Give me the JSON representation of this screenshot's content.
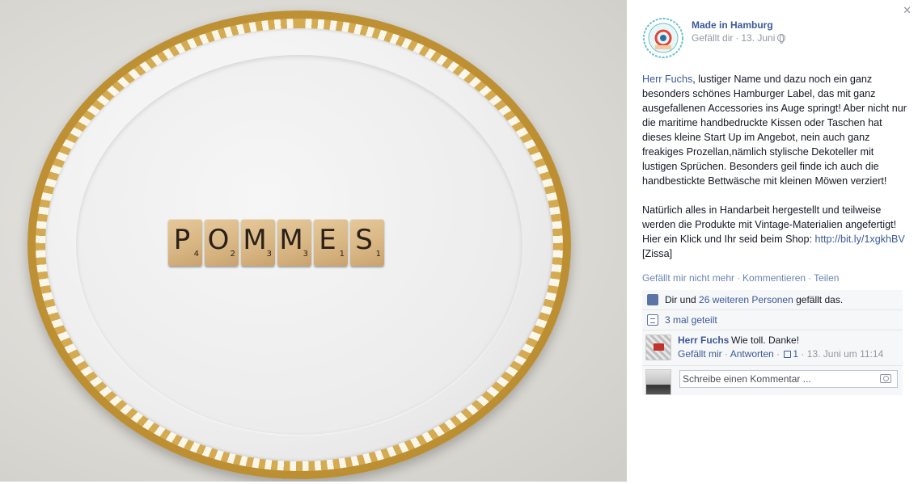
{
  "photo": {
    "tiles": [
      {
        "letter": "P",
        "score": "4"
      },
      {
        "letter": "O",
        "score": "2"
      },
      {
        "letter": "M",
        "score": "3"
      },
      {
        "letter": "M",
        "score": "3"
      },
      {
        "letter": "E",
        "score": "1"
      },
      {
        "letter": "S",
        "score": "1"
      }
    ]
  },
  "post": {
    "author": "Made in Hamburg",
    "liked_by_you": "Gefällt dir",
    "date": "13. Juni",
    "close_icon": "close-icon",
    "text": {
      "mention": "Herr Fuchs",
      "para1_rest": ", lustiger Name und dazu noch ein ganz besonders schönes Hamburger Label, das mit ganz ausgefallenen Accessories ins Auge springt! Aber nicht nur die maritime handbedruckte Kissen oder Taschen hat dieses kleine Start Up im Angebot, nein auch ganz freakiges Prozellan,nämlich stylische Dekoteller mit lustigen Sprüchen. Besonders geil finde ich auch die handbestickte Bettwäsche mit kleinen Möwen verziert!",
      "para2": "Natürlich alles in Handarbeit hergestellt und teilweise werden die Produkte mit Vintage-Materialien angefertigt! Hier ein Klick und Ihr seid beim Shop: ",
      "link": "http://bit.ly/1xgkhBV",
      "signature": " [Zissa]"
    },
    "actions": {
      "unlike": "Gefällt mir nicht mehr",
      "comment": "Kommentieren",
      "share": "Teilen"
    }
  },
  "ufi": {
    "likes_prefix": "Dir und ",
    "likes_link": "26 weiteren Personen",
    "likes_suffix": " gefällt das.",
    "shares": "3 mal geteilt",
    "comment": {
      "author": "Herr Fuchs",
      "text": "Wie toll. Danke!",
      "like": "Gefällt mir",
      "reply": "Antworten",
      "like_count": "1",
      "time": "13. Juni um 11:14"
    },
    "input_placeholder": "Schreibe einen Kommentar ..."
  }
}
